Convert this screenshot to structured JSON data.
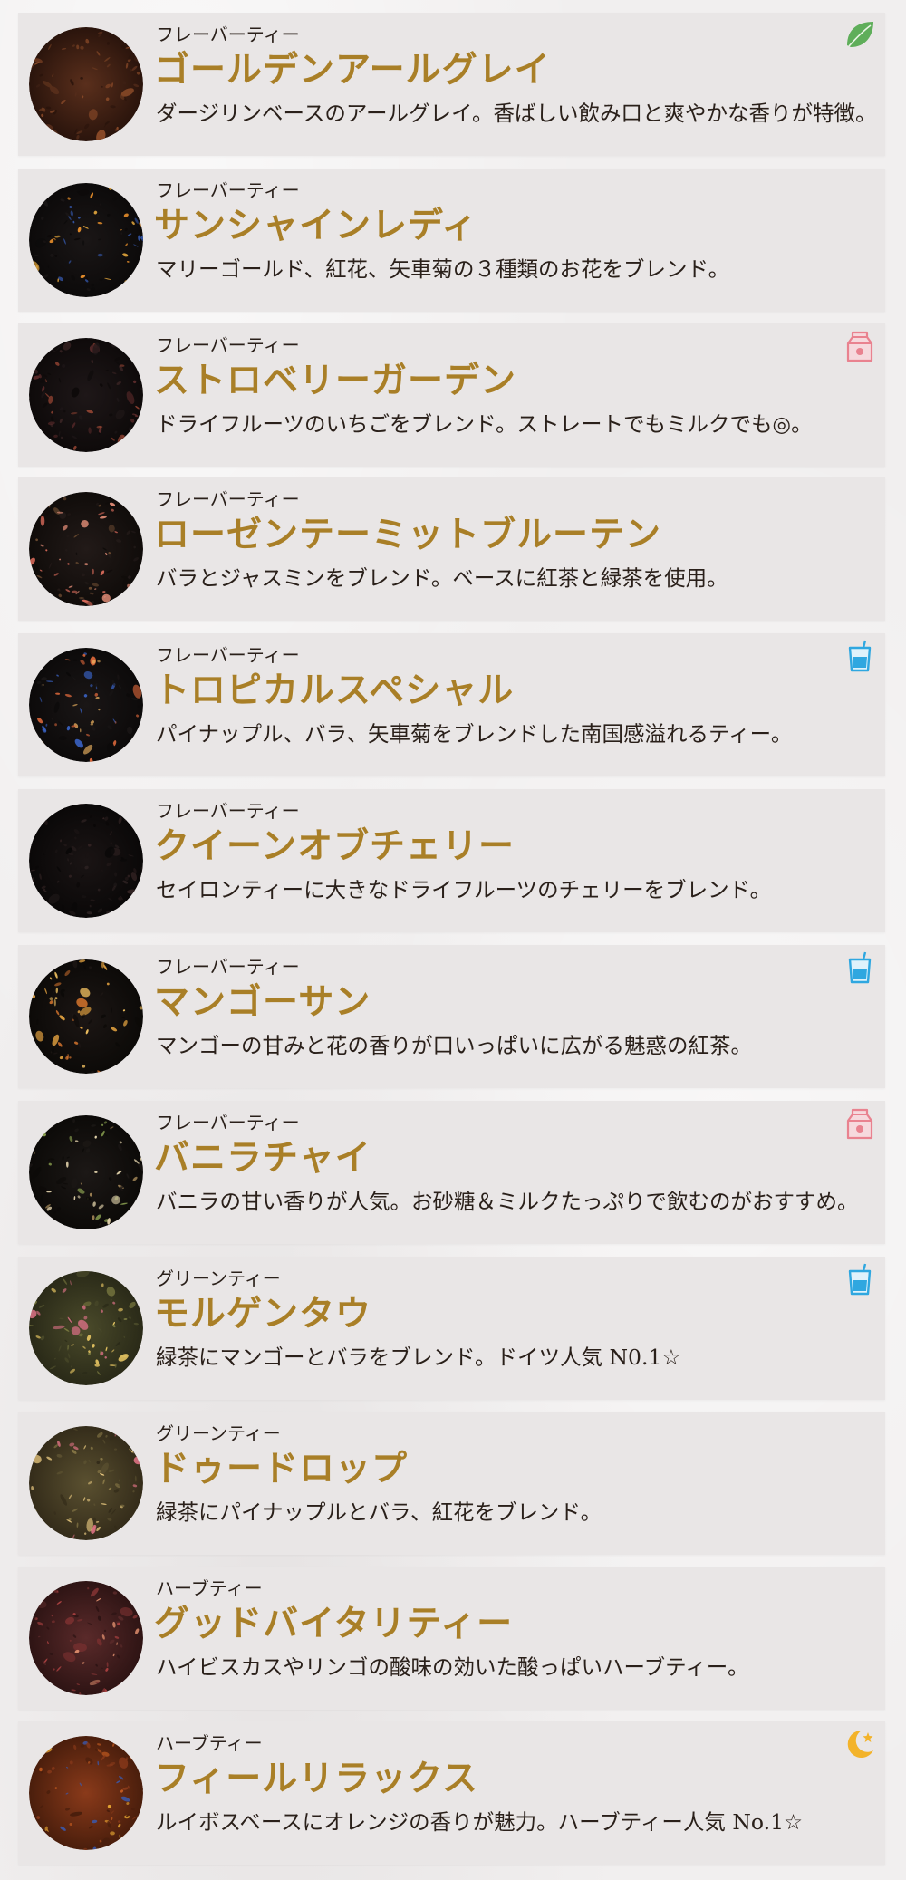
{
  "items": [
    {
      "category": "フレーバーティー",
      "name": "ゴールデンアールグレイ",
      "description": "ダージリンベースのアールグレイ。香ばしい飲み口と爽やかな香りが特徴。",
      "icon": "leaf-icon",
      "colors": {
        "base": "#5a2f1c",
        "dark": "#2a140c",
        "a": "#8a4a28",
        "b": "#3e2014",
        "c": "#6b3a20"
      }
    },
    {
      "category": "フレーバーティー",
      "name": "サンシャインレディ",
      "description": "マリーゴールド、紅花、矢車菊の３種類のお花をブレンド。",
      "icon": null,
      "colors": {
        "base": "#1a1616",
        "dark": "#0c0a0a",
        "a": "#e08a2a",
        "b": "#3456a8",
        "c": "#f0b040"
      }
    },
    {
      "category": "フレーバーティー",
      "name": "ストロベリーガーデン",
      "description": "ドライフルーツのいちごをブレンド。ストレートでもミルクでも◎。",
      "icon": "milk-carton-icon",
      "colors": {
        "base": "#1e1718",
        "dark": "#0e0a0a",
        "a": "#5a2a2a",
        "b": "#8a4030",
        "c": "#3a2424"
      }
    },
    {
      "category": "フレーバーティー",
      "name": "ローゼンテーミットブルーテン",
      "description": "バラとジャスミンをブレンド。ベースに紅茶と緑茶を使用。",
      "icon": null,
      "colors": {
        "base": "#221a18",
        "dark": "#100c0a",
        "a": "#d86a5a",
        "b": "#e8907a",
        "c": "#6a4a30"
      }
    },
    {
      "category": "フレーバーティー",
      "name": "トロピカルスペシャル",
      "description": "パイナップル、バラ、矢車菊をブレンドした南国感溢れるティー。",
      "icon": "iced-drink-icon",
      "colors": {
        "base": "#1a1616",
        "dark": "#0c0a0a",
        "a": "#d8663a",
        "b": "#3a64c8",
        "c": "#e8b060"
      }
    },
    {
      "category": "フレーバーティー",
      "name": "クイーンオブチェリー",
      "description": "セイロンティーに大きなドライフルーツのチェリーをブレンド。",
      "icon": null,
      "colors": {
        "base": "#1a1414",
        "dark": "#0a0808",
        "a": "#2a2020",
        "b": "#3a2828",
        "c": "#241a1a"
      }
    },
    {
      "category": "フレーバーティー",
      "name": "マンゴーサン",
      "description": "マンゴーの甘みと花の香りが口いっぱいに広がる魅惑の紅茶。",
      "icon": "iced-drink-icon",
      "colors": {
        "base": "#1c1614",
        "dark": "#0c0a08",
        "a": "#e0a040",
        "b": "#c06a2a",
        "c": "#f0c060"
      }
    },
    {
      "category": "フレーバーティー",
      "name": "バニラチャイ",
      "description": "バニラの甘い香りが人気。お砂糖＆ミルクたっぷりで飲むのがおすすめ。",
      "icon": "milk-carton-icon",
      "colors": {
        "base": "#1c1816",
        "dark": "#0c0a08",
        "a": "#8aa050",
        "b": "#e8d8b0",
        "c": "#a88a5a"
      }
    },
    {
      "category": "グリーンティー",
      "name": "モルゲンタウ",
      "description": "緑茶にマンゴーとバラをブレンド。ドイツ人気 N0.1☆",
      "icon": "iced-drink-icon",
      "colors": {
        "base": "#4a4a2a",
        "dark": "#2a2a18",
        "a": "#7a7a40",
        "b": "#c86a7a",
        "c": "#e0c060"
      }
    },
    {
      "category": "グリーンティー",
      "name": "ドゥードロップ",
      "description": "緑茶にパイナップルとバラ、紅花をブレンド。",
      "icon": null,
      "colors": {
        "base": "#5a5030",
        "dark": "#342c1a",
        "a": "#8a7a48",
        "b": "#d87080",
        "c": "#e8c880"
      }
    },
    {
      "category": "ハーブティー",
      "name": "グッドバイタリティー",
      "description": "ハイビスカスやリンゴの酸味の効いた酸っぱいハーブティー。",
      "icon": null,
      "colors": {
        "base": "#5a2a2a",
        "dark": "#2e1414",
        "a": "#a84040",
        "b": "#d88a6a",
        "c": "#7a3030"
      }
    },
    {
      "category": "ハーブティー",
      "name": "フィールリラックス",
      "description": "ルイボスベースにオレンジの香りが魅力。ハーブティー人気 No.1☆",
      "icon": "moon-star-icon",
      "colors": {
        "base": "#8a3a1a",
        "dark": "#4a1e0c",
        "a": "#e0a030",
        "b": "#3a5ab0",
        "c": "#c05a20"
      }
    }
  ]
}
